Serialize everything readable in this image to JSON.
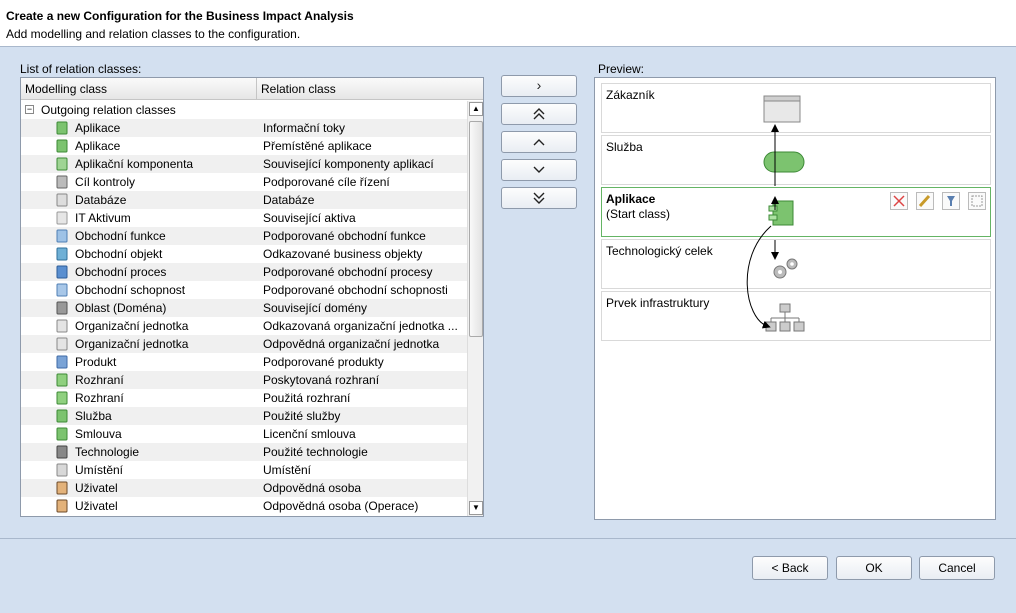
{
  "header": {
    "title": "Create a new Configuration for the Business Impact Analysis",
    "subtitle": "Add modelling and relation classes to the configuration."
  },
  "list": {
    "label": "List of relation classes:",
    "col_modelling": "Modelling class",
    "col_relation": "Relation class",
    "group": "Outgoing relation classes",
    "rows": [
      {
        "mc": "Aplikace",
        "rc": "Informační toky",
        "icon": "application-icon"
      },
      {
        "mc": "Aplikace",
        "rc": "Přemístěné aplikace",
        "icon": "application-icon"
      },
      {
        "mc": "Aplikační komponenta",
        "rc": "Související komponenty aplikací",
        "icon": "app-component-icon"
      },
      {
        "mc": "Cíl kontroly",
        "rc": "Podporované cíle řízení",
        "icon": "control-objective-icon"
      },
      {
        "mc": "Databáze",
        "rc": "Databáze",
        "icon": "database-icon"
      },
      {
        "mc": "IT Aktivum",
        "rc": "Související aktiva",
        "icon": "it-asset-icon"
      },
      {
        "mc": "Obchodní funkce",
        "rc": "Podporované obchodní funkce",
        "icon": "business-function-icon"
      },
      {
        "mc": "Obchodní objekt",
        "rc": "Odkazované business objekty",
        "icon": "business-object-icon"
      },
      {
        "mc": "Obchodní proces",
        "rc": "Podporované obchodní procesy",
        "icon": "business-process-icon"
      },
      {
        "mc": "Obchodní schopnost",
        "rc": "Podporované obchodní schopnosti",
        "icon": "business-capability-icon"
      },
      {
        "mc": "Oblast (Doména)",
        "rc": "Související domény",
        "icon": "domain-icon"
      },
      {
        "mc": "Organizační jednotka",
        "rc": "Odkazovaná organizační jednotka ...",
        "icon": "org-unit-icon"
      },
      {
        "mc": "Organizační jednotka",
        "rc": "Odpovědná organizační jednotka",
        "icon": "org-unit-icon"
      },
      {
        "mc": "Produkt",
        "rc": "Podporované produkty",
        "icon": "product-icon"
      },
      {
        "mc": "Rozhraní",
        "rc": "Poskytovaná rozhraní",
        "icon": "interface-icon"
      },
      {
        "mc": "Rozhraní",
        "rc": "Použitá rozhraní",
        "icon": "interface-icon"
      },
      {
        "mc": "Služba",
        "rc": "Použité služby",
        "icon": "service-icon"
      },
      {
        "mc": "Smlouva",
        "rc": "Licenční smlouva",
        "icon": "contract-icon"
      },
      {
        "mc": "Technologie",
        "rc": "Použité technologie",
        "icon": "technology-icon"
      },
      {
        "mc": "Umístění",
        "rc": "Umístění",
        "icon": "location-icon"
      },
      {
        "mc": "Uživatel",
        "rc": "Odpovědná osoba",
        "icon": "user-icon"
      },
      {
        "mc": "Uživatel",
        "rc": "Odpovědná osoba (Operace)",
        "icon": "user-icon"
      }
    ]
  },
  "buttons": {
    "add": "›",
    "move_top": "«",
    "move_up": "‹",
    "move_down": "›",
    "move_bottom": "»",
    "back": "< Back",
    "ok": "OK",
    "cancel": "Cancel"
  },
  "preview": {
    "label": "Preview:",
    "boxes": [
      {
        "title": "Zákazník",
        "sub": ""
      },
      {
        "title": "Služba",
        "sub": ""
      },
      {
        "title": "Aplikace",
        "sub": "(Start class)"
      },
      {
        "title": "Technologický celek",
        "sub": ""
      },
      {
        "title": "Prvek infrastruktury",
        "sub": ""
      }
    ]
  }
}
